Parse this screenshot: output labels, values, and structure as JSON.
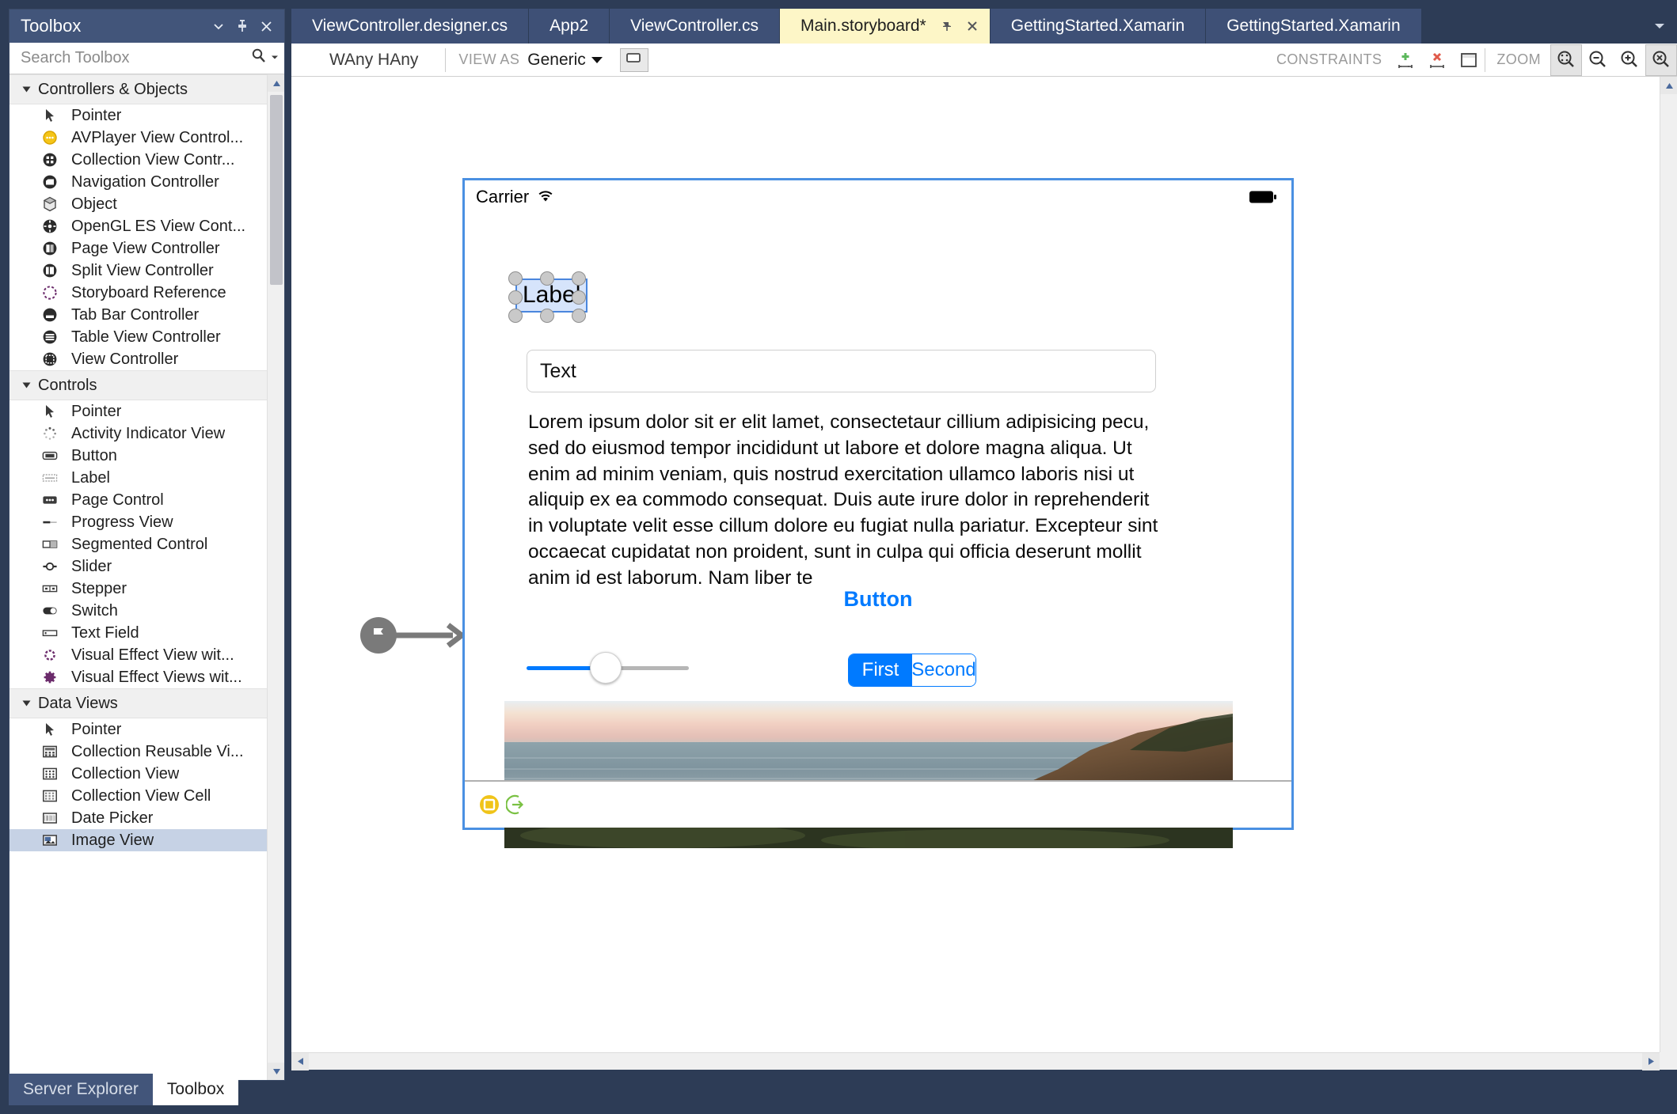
{
  "toolbox": {
    "title": "Toolbox",
    "search_placeholder": "Search Toolbox",
    "collapse_icon": "chevron-down-icon",
    "pin_icon": "pin-icon",
    "close_icon": "close-icon",
    "search_icon": "search-icon",
    "search_dropdown_icon": "chevron-down-icon",
    "groups": [
      {
        "label": "Controllers & Objects",
        "items": [
          {
            "label": "Pointer",
            "icon": "pointer-icon"
          },
          {
            "label": "AVPlayer View Control...",
            "icon": "avplayer-controller-icon"
          },
          {
            "label": "Collection View Contr...",
            "icon": "collection-view-controller-icon"
          },
          {
            "label": "Navigation Controller",
            "icon": "navigation-controller-icon"
          },
          {
            "label": "Object",
            "icon": "object-icon"
          },
          {
            "label": "OpenGL ES View Cont...",
            "icon": "opengl-view-controller-icon"
          },
          {
            "label": "Page View Controller",
            "icon": "page-view-controller-icon"
          },
          {
            "label": "Split View Controller",
            "icon": "split-view-controller-icon"
          },
          {
            "label": "Storyboard Reference",
            "icon": "storyboard-reference-icon"
          },
          {
            "label": "Tab Bar Controller",
            "icon": "tab-bar-controller-icon"
          },
          {
            "label": "Table View Controller",
            "icon": "table-view-controller-icon"
          },
          {
            "label": "View Controller",
            "icon": "view-controller-icon"
          }
        ]
      },
      {
        "label": "Controls",
        "items": [
          {
            "label": "Pointer",
            "icon": "pointer-icon"
          },
          {
            "label": "Activity Indicator View",
            "icon": "activity-indicator-icon"
          },
          {
            "label": "Button",
            "icon": "button-icon"
          },
          {
            "label": "Label",
            "icon": "label-icon"
          },
          {
            "label": "Page Control",
            "icon": "page-control-icon"
          },
          {
            "label": "Progress View",
            "icon": "progress-view-icon"
          },
          {
            "label": "Segmented Control",
            "icon": "segmented-control-icon"
          },
          {
            "label": "Slider",
            "icon": "slider-icon"
          },
          {
            "label": "Stepper",
            "icon": "stepper-icon"
          },
          {
            "label": "Switch",
            "icon": "switch-icon"
          },
          {
            "label": "Text Field",
            "icon": "text-field-icon"
          },
          {
            "label": "Visual Effect View wit...",
            "icon": "visual-effect-view-icon"
          },
          {
            "label": "Visual Effect Views wit...",
            "icon": "visual-effect-views-icon"
          }
        ]
      },
      {
        "label": "Data Views",
        "items": [
          {
            "label": "Pointer",
            "icon": "pointer-icon"
          },
          {
            "label": "Collection Reusable Vi...",
            "icon": "collection-reusable-view-icon"
          },
          {
            "label": "Collection View",
            "icon": "collection-view-icon"
          },
          {
            "label": "Collection View Cell",
            "icon": "collection-view-cell-icon"
          },
          {
            "label": "Date Picker",
            "icon": "date-picker-icon"
          },
          {
            "label": "Image View",
            "icon": "image-view-icon",
            "selected": true
          }
        ]
      }
    ],
    "bottom_tabs": [
      {
        "label": "Server Explorer",
        "active": false
      },
      {
        "label": "Toolbox",
        "active": true
      }
    ]
  },
  "editor": {
    "tabs": [
      {
        "label": "ViewController.designer.cs",
        "active": false
      },
      {
        "label": "App2",
        "active": false
      },
      {
        "label": "ViewController.cs",
        "active": false
      },
      {
        "label": "Main.storyboard*",
        "active": true
      },
      {
        "label": "GettingStarted.Xamarin",
        "active": false
      },
      {
        "label": "GettingStarted.Xamarin",
        "active": false
      }
    ],
    "active_tab_pin_icon": "pin-icon",
    "active_tab_close_icon": "close-icon",
    "tab_overflow_icon": "chevron-down-icon"
  },
  "designer_toolbar": {
    "size_class": "WAny HAny",
    "view_as_label": "VIEW AS",
    "view_as_value": "Generic",
    "device_button_icon": "device-icon",
    "constraints_label": "CONSTRAINTS",
    "add_constraint_icon": "add-constraint-icon",
    "remove_constraint_icon": "remove-constraint-icon",
    "frame_constraint_icon": "frame-constraint-icon",
    "zoom_label": "ZOOM",
    "zoom_fit_icon": "zoom-fit-icon",
    "zoom_out_icon": "zoom-out-icon",
    "zoom_in_icon": "zoom-in-icon",
    "zoom_reset_icon": "zoom-reset-icon"
  },
  "canvas": {
    "entry_point_icon": "flag-icon",
    "device": {
      "status_bar": {
        "carrier": "Carrier",
        "wifi_icon": "wifi-icon",
        "battery_icon": "battery-icon"
      },
      "label_widget": {
        "text": "Label",
        "selected": true
      },
      "text_field": {
        "value": "Text"
      },
      "text_view": {
        "text": "Lorem ipsum dolor sit er elit lamet, consectetaur cillium adipisicing pecu, sed do eiusmod tempor incididunt ut labore et dolore magna aliqua. Ut enim ad minim veniam, quis nostrud exercitation ullamco laboris nisi ut aliquip ex ea commodo consequat. Duis aute irure dolor in reprehenderit in voluptate velit esse cillum dolore eu fugiat nulla pariatur. Excepteur sint occaecat cupidatat non proident, sunt in culpa qui officia deserunt mollit anim id est laborum. Nam liber te"
      },
      "button": {
        "label": "Button"
      },
      "slider": {
        "value_percent": 48
      },
      "segmented_control": {
        "segments": [
          {
            "label": "First",
            "selected": true
          },
          {
            "label": "Second",
            "selected": false
          }
        ]
      },
      "image_view": {
        "description": "coastal sunset photo"
      },
      "dock": {
        "view_controller_icon": "view-controller-dock-icon",
        "exit_icon": "exit-dock-icon"
      }
    }
  },
  "colors": {
    "vs_chrome": "#2d3c56",
    "panel_title": "#42557a",
    "active_tab": "#fdf6c7",
    "ios_blue": "#007aff",
    "selection_blue": "#4a86dd",
    "device_border": "#4a90e2"
  }
}
